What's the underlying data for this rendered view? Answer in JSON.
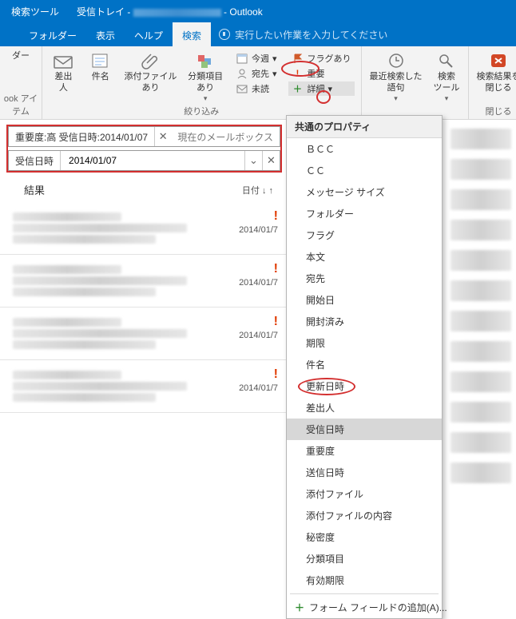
{
  "titlebar": {
    "context_tab": "検索ツール",
    "window_title_prefix": "受信トレイ - ",
    "window_title_suffix": " - Outlook"
  },
  "tabs": {
    "items": [
      "",
      "フォルダー",
      "表示",
      "ヘルプ",
      "検索"
    ],
    "active_index": 4,
    "tellme": "実行したい作業を入力してください"
  },
  "ribbon": {
    "group1_label": "ook アイテム",
    "group1_btn": "ダー",
    "sender": "差出人",
    "subject": "件名",
    "has_attachment": "添付ファイル\nあり",
    "categorized": "分類項目\nあり",
    "this_week": "今週",
    "to": "宛先",
    "unread": "未読",
    "flagged": "フラグあり",
    "important": "重要",
    "more": "詳細",
    "refine_label": "絞り込み",
    "recent": "最近検索した\n語句",
    "tools": "検索\nツール",
    "close_results": "検索結果を\n閉じる",
    "close_label": "閉じる"
  },
  "search": {
    "query_text": "重要度:高 受信日時:2014/01/07",
    "scope": "現在のメールボックス",
    "field_label": "受信日時",
    "field_value": "2014/01/07"
  },
  "results": {
    "heading": "結果",
    "sort_label": "日付",
    "items": [
      {
        "date": "2014/01/7",
        "important": true
      },
      {
        "date": "2014/01/7",
        "important": true
      },
      {
        "date": "2014/01/7",
        "important": true
      },
      {
        "date": "2014/01/7",
        "important": true
      }
    ]
  },
  "menu": {
    "header": "共通のプロパティ",
    "items": [
      "ＢＣＣ",
      "ＣＣ",
      "メッセージ サイズ",
      "フォルダー",
      "フラグ",
      "本文",
      "宛先",
      "開始日",
      "開封済み",
      "期限",
      "件名",
      "更新日時",
      "差出人",
      "受信日時",
      "重要度",
      "送信日時",
      "添付ファイル",
      "添付ファイルの内容",
      "秘密度",
      "分類項目",
      "有効期限"
    ],
    "highlight_index": 13,
    "add_field": "フォーム フィールドの追加(A)..."
  }
}
